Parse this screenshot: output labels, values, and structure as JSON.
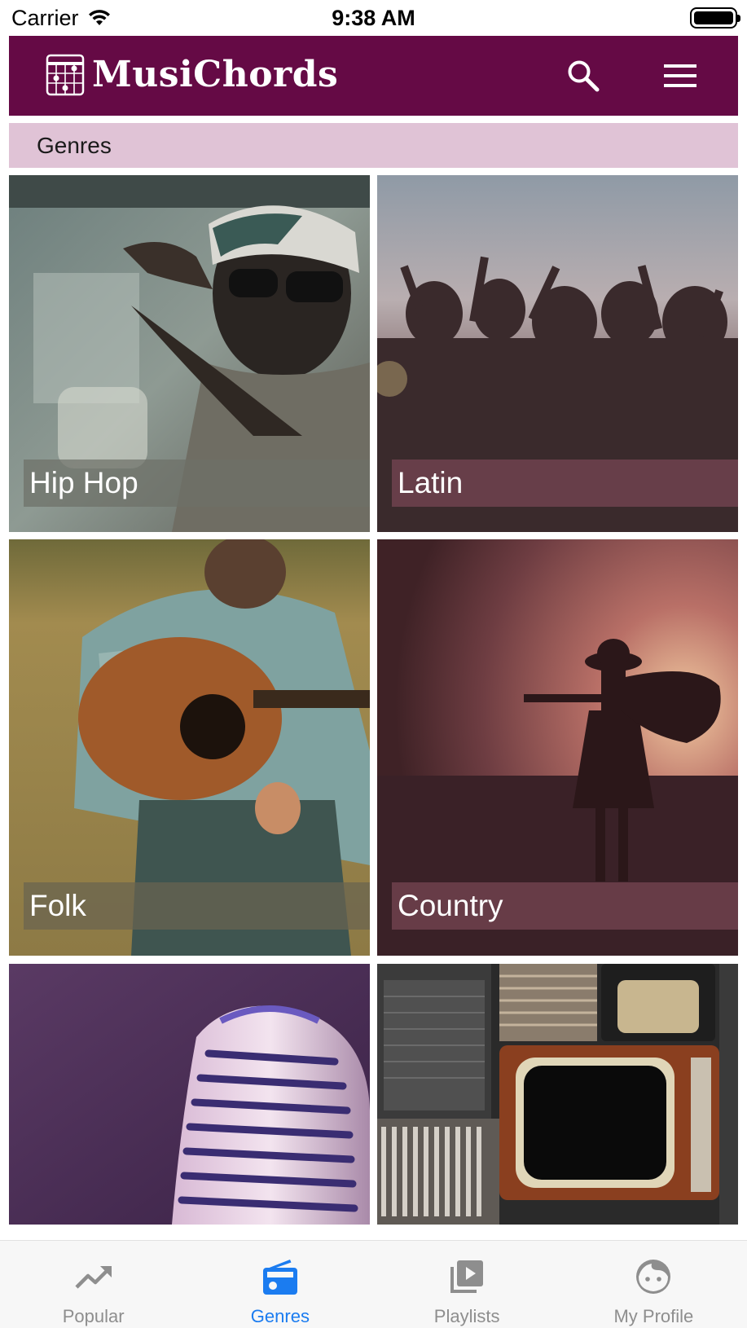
{
  "status_bar": {
    "carrier": "Carrier",
    "time": "9:38 AM"
  },
  "header": {
    "app_name": "MusiChords",
    "brand_color": "#650a45"
  },
  "section": {
    "title": "Genres",
    "background": "#e0c3d6"
  },
  "genres": [
    {
      "label": "Hip Hop",
      "image": "man-in-car-with-cap-and-sunglasses"
    },
    {
      "label": "Latin",
      "image": "concert-crowd-silhouettes"
    },
    {
      "label": "Folk",
      "image": "man-with-acoustic-guitar-in-field"
    },
    {
      "label": "Country",
      "image": "cowgirl-silhouette-sunset-guitar"
    },
    {
      "label": "",
      "image": "vintage-microphone-purple"
    },
    {
      "label": "",
      "image": "retro-tv-records-shelves"
    }
  ],
  "tabs": [
    {
      "label": "Popular",
      "icon": "trending-up-icon",
      "active": false
    },
    {
      "label": "Genres",
      "icon": "radio-icon",
      "active": true
    },
    {
      "label": "Playlists",
      "icon": "playlist-play-icon",
      "active": false
    },
    {
      "label": "My Profile",
      "icon": "face-icon",
      "active": false
    }
  ],
  "colors": {
    "active_tab": "#1b7cf0",
    "inactive_tab": "#8e8e8e"
  }
}
